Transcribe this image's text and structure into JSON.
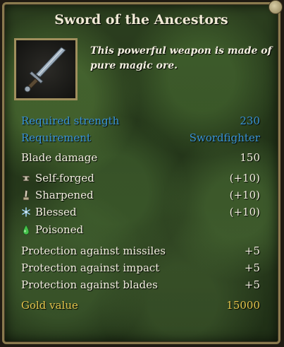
{
  "item": {
    "title": "Sword of the Ancestors",
    "description": "This powerful weapon is made of pure magic ore.",
    "icon": "sword-icon"
  },
  "requirements": [
    {
      "label": "Required strength",
      "value": "230"
    },
    {
      "label": "Requirement",
      "value": "Swordfighter"
    }
  ],
  "damage": {
    "label": "Blade damage",
    "value": "150"
  },
  "enchantments": [
    {
      "label": "Self-forged",
      "value": "(+10)",
      "icon": "anvil-icon"
    },
    {
      "label": "Sharpened",
      "value": "(+10)",
      "icon": "whetstone-icon"
    },
    {
      "label": "Blessed",
      "value": "(+10)",
      "icon": "snowflake-icon"
    },
    {
      "label": "Poisoned",
      "value": "",
      "icon": "poison-drop-icon"
    }
  ],
  "protections": [
    {
      "label": "Protection against missiles",
      "value": "+5"
    },
    {
      "label": "Protection against impact",
      "value": "+5"
    },
    {
      "label": "Protection against blades",
      "value": "+5"
    }
  ],
  "gold": {
    "label": "Gold value",
    "value": "15000"
  },
  "colors": {
    "requirement_text": "#3a93d6",
    "stat_text": "#f3efe0",
    "gold_text": "#e2c24b",
    "border": "#8a7a4e"
  }
}
